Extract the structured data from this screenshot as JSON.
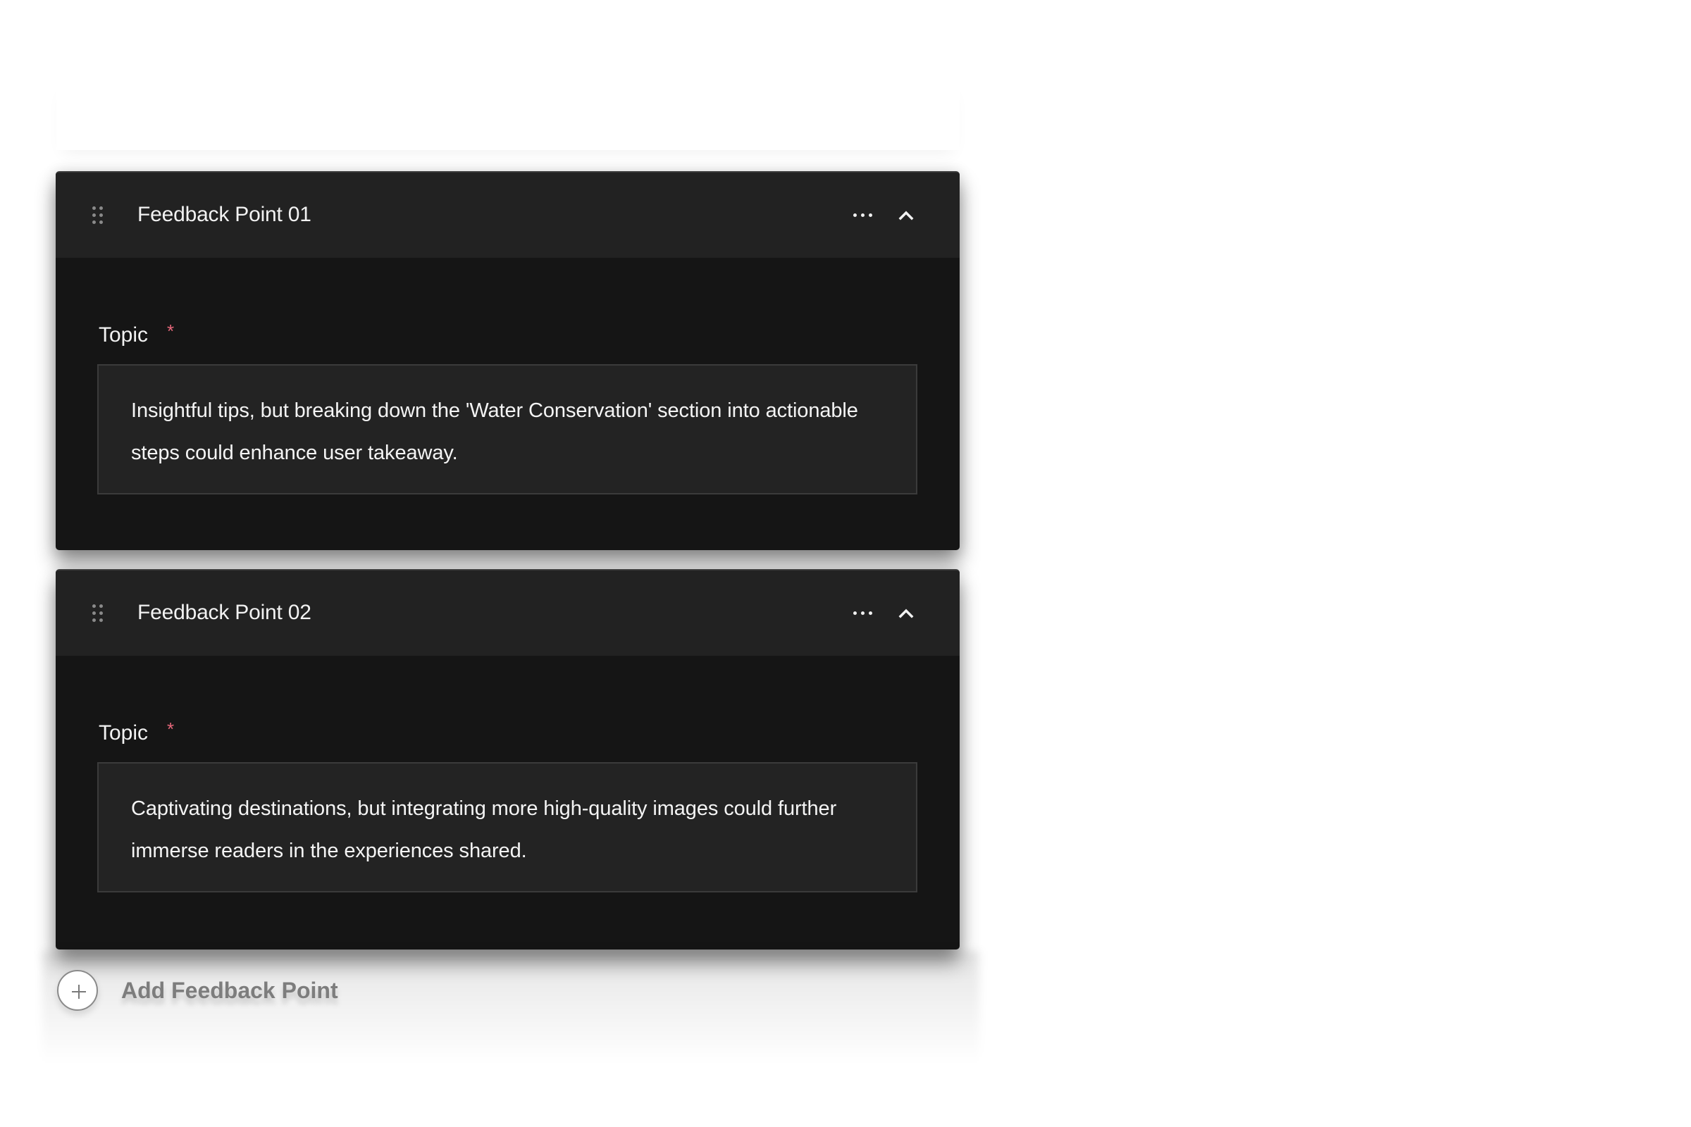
{
  "feedback_points": [
    {
      "title": "Feedback Point 01",
      "field_label": "Topic",
      "required_marker": "*",
      "value": "Insightful tips, but breaking down the 'Water Conservation' section into actionable steps could enhance user takeaway.",
      "icons": {
        "drag": "drag-handle-icon",
        "more": "more-horizontal-icon",
        "collapse": "chevron-up-icon"
      },
      "expanded": true
    },
    {
      "title": "Feedback Point 02",
      "field_label": "Topic",
      "required_marker": "*",
      "value": "Captivating destinations, but integrating more high-quality images could further immerse readers in the experiences shared.",
      "icons": {
        "drag": "drag-handle-icon",
        "more": "more-horizontal-icon",
        "collapse": "chevron-up-icon"
      },
      "expanded": true
    }
  ],
  "add_button": {
    "label": "Add Feedback Point",
    "icon": "plus-icon"
  },
  "colors": {
    "card_header": "#222222",
    "card_body": "#151515",
    "textarea_bg": "#232323",
    "textarea_border": "#3b3b3b",
    "required": "#e5677a",
    "add_label": "#7d7d7d"
  }
}
